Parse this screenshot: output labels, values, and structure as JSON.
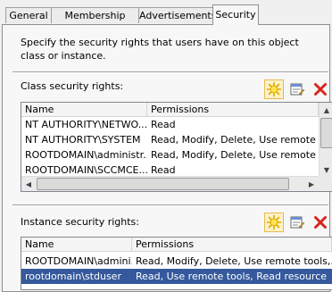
{
  "tabs": [
    {
      "label": "General"
    },
    {
      "label": "Membership Rules"
    },
    {
      "label": "Advertisements"
    },
    {
      "label": "Security"
    }
  ],
  "intro_text": "Specify the security rights that users have on this object class or instance.",
  "class_section": {
    "label": "Class security rights:",
    "columns": [
      "Name",
      "Permissions"
    ],
    "rows": [
      {
        "name": "NT AUTHORITY\\NETWO...",
        "permissions": "Read"
      },
      {
        "name": "NT AUTHORITY\\SYSTEM",
        "permissions": "Read, Modify, Delete, Use remote t..."
      },
      {
        "name": "ROOTDOMAIN\\administr...",
        "permissions": "Read, Modify, Delete, Use remote t..."
      },
      {
        "name": "ROOTDOMAIN\\SCCMCE...",
        "permissions": "Read"
      }
    ]
  },
  "instance_section": {
    "label": "Instance security rights:",
    "columns": [
      "Name",
      "Permissions"
    ],
    "rows": [
      {
        "name": "ROOTDOMAIN\\admini...",
        "permissions": "Read, Modify, Delete, Use remote tools,..."
      },
      {
        "name": "rootdomain\\stduser",
        "permissions": "Read, Use remote tools, Read resource"
      }
    ],
    "selected_row": "rootdomain\\stduser"
  },
  "toolbar_icons": [
    "new-permission-icon",
    "properties-icon",
    "delete-icon"
  ],
  "colors": {
    "selection": "#35599c",
    "delete": "#d9261c",
    "star": "#f2c200"
  }
}
